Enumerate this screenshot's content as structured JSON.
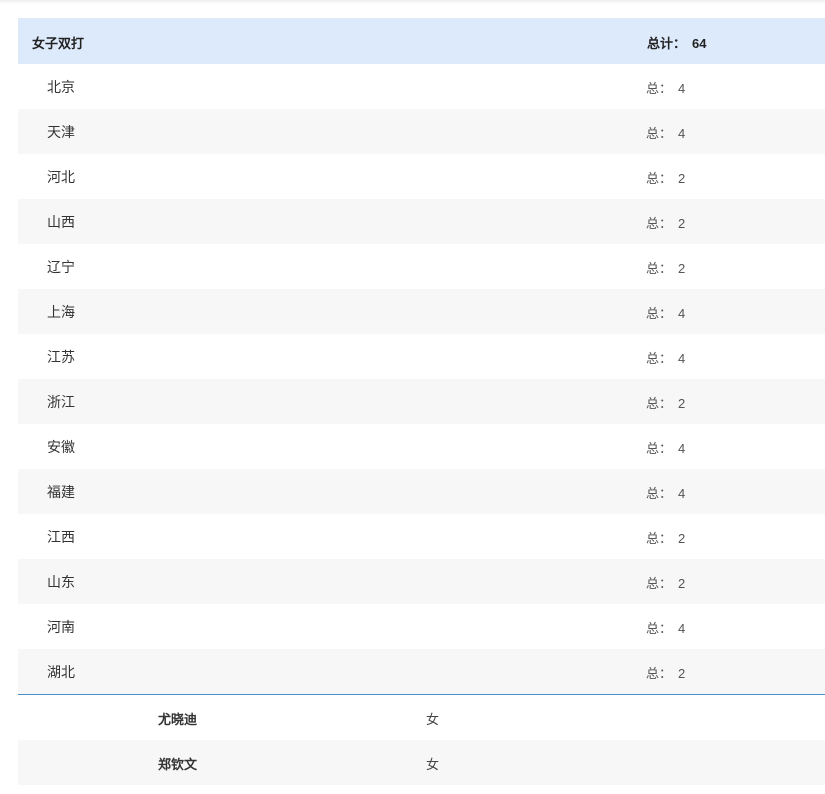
{
  "section": {
    "title": "女子双打",
    "total_label": "总计：",
    "total_value": "64"
  },
  "row_total_label": "总：",
  "provinces": [
    {
      "name": "北京",
      "total": "4"
    },
    {
      "name": "天津",
      "total": "4"
    },
    {
      "name": "河北",
      "total": "2"
    },
    {
      "name": "山西",
      "total": "2"
    },
    {
      "name": "辽宁",
      "total": "2"
    },
    {
      "name": "上海",
      "total": "4"
    },
    {
      "name": "江苏",
      "total": "4"
    },
    {
      "name": "浙江",
      "total": "2"
    },
    {
      "name": "安徽",
      "total": "4"
    },
    {
      "name": "福建",
      "total": "4"
    },
    {
      "name": "江西",
      "total": "2"
    },
    {
      "name": "山东",
      "total": "2"
    },
    {
      "name": "河南",
      "total": "4"
    },
    {
      "name": "湖北",
      "total": "2"
    }
  ],
  "players": [
    {
      "name": "尤晓迪",
      "gender": "女"
    },
    {
      "name": "郑钦文",
      "gender": "女"
    }
  ]
}
